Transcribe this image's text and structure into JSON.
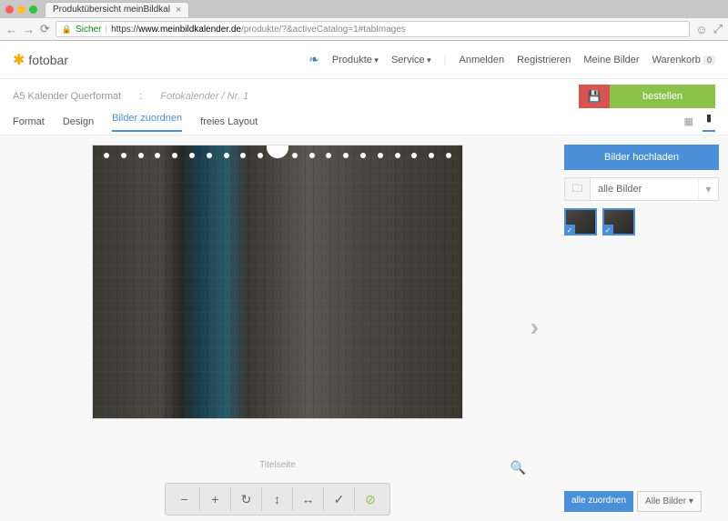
{
  "browser": {
    "tab_title": "Produktübersicht meinBildkal",
    "secure_label": "Sicher",
    "url_scheme": "https",
    "url_domain": "www.meinbildkalender.de",
    "url_path": "/produkte/?&activeCatalog=1#tabImages"
  },
  "header": {
    "logo": "fotobar",
    "nav": {
      "produkte": "Produkte",
      "service": "Service"
    },
    "right": {
      "anmelden": "Anmelden",
      "registrieren": "Registrieren",
      "meine_bilder": "Meine Bilder",
      "warenkorb": "Warenkorb",
      "cart_count": "0"
    }
  },
  "breadcrumb": {
    "product": "A5 Kalender Querformat",
    "sep": ":",
    "variant": "Fotokalender / Nr. 1"
  },
  "order_button": "bestellen",
  "tabs": {
    "format": "Format",
    "design": "Design",
    "bilder": "Bilder zuordnen",
    "freies": "freies Layout"
  },
  "canvas": {
    "caption": "Titelseite",
    "toolbar_icons": [
      "−",
      "+",
      "↻",
      "↕",
      "↔",
      "✓",
      "⊘"
    ]
  },
  "sidebar": {
    "upload": "Bilder hochladen",
    "filter": "alle Bilder",
    "bottom": {
      "assign": "alle zuordnen",
      "all": "Alle Bilder"
    }
  }
}
